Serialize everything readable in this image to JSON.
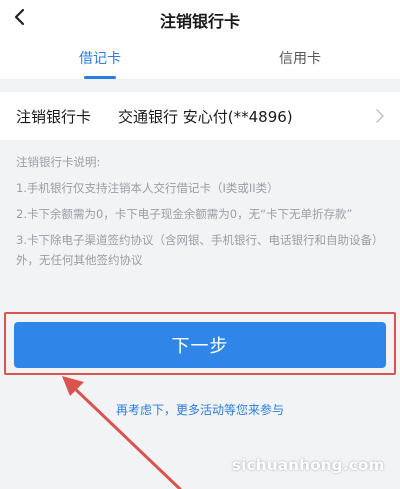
{
  "nav": {
    "title": "注销银行卡"
  },
  "tabs": [
    {
      "label": "借记卡",
      "active": true
    },
    {
      "label": "信用卡",
      "active": false
    }
  ],
  "card_row": {
    "label": "注销银行卡",
    "value": "交通银行 安心付(**4896)"
  },
  "notes": {
    "heading": "注销银行卡说明:",
    "items": [
      "1.手机银行仅支持注销本人交行借记卡（I类或II类）",
      "2.卡下余额需为0，卡下电子现金余额需为0，无“卡下无单折存款”",
      "3.卡下除电子渠道签约协议（含网银、手机银行、电话银行和自助设备）外，无任何其他签约协议"
    ]
  },
  "next_button": {
    "label": "下一步"
  },
  "reconsider_link": {
    "label": "再考虑下，更多活动等您来参与"
  },
  "watermark": "sichuanhong.com",
  "colors": {
    "accent": "#2a7de1",
    "button": "#2f86e8",
    "highlight": "#d9534f",
    "note_text": "#9a9ea6",
    "background": "#f2f3f5"
  }
}
